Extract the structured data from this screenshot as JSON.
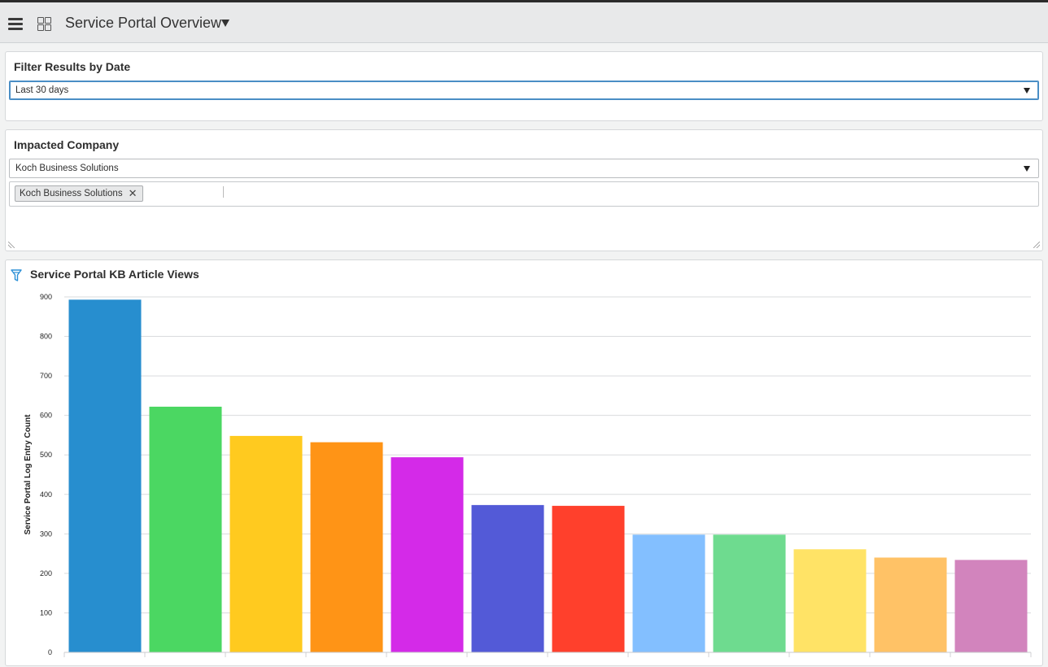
{
  "header": {
    "title": "Service Portal Overview"
  },
  "filter_panel": {
    "title": "Filter Results by Date",
    "selected": "Last 30 days"
  },
  "company_panel": {
    "title": "Impacted Company",
    "selected": "Koch Business Solutions",
    "tags": [
      "Koch Business Solutions"
    ],
    "tag_remove_glyph": "✕"
  },
  "chart_panel": {
    "title": "Service Portal KB Article Views"
  },
  "chart_data": {
    "type": "bar",
    "ylabel": "Service Portal Log Entry Count",
    "xlabel": "",
    "ylim": [
      0,
      900
    ],
    "yticks": [
      0,
      100,
      200,
      300,
      400,
      500,
      600,
      700,
      800,
      900
    ],
    "grid": true,
    "categories": [
      "",
      "",
      "",
      "",
      "",
      "",
      "",
      "",
      "",
      "",
      "",
      ""
    ],
    "values": [
      893,
      622,
      548,
      532,
      494,
      373,
      371,
      298,
      298,
      261,
      240,
      234
    ],
    "colors": [
      "#278ecf",
      "#4bd762",
      "#ffca1f",
      "#ff9416",
      "#d42ae8",
      "#535ad7",
      "#ff402c",
      "#83bfff",
      "#6edb8f",
      "#ffe366",
      "#ffc266",
      "#d284bd"
    ]
  },
  "icons": {
    "menu": "hamburger-icon",
    "dashboards": "grid-icon",
    "title_menu": "caret-down-icon",
    "chart_filter": "funnel-icon"
  }
}
